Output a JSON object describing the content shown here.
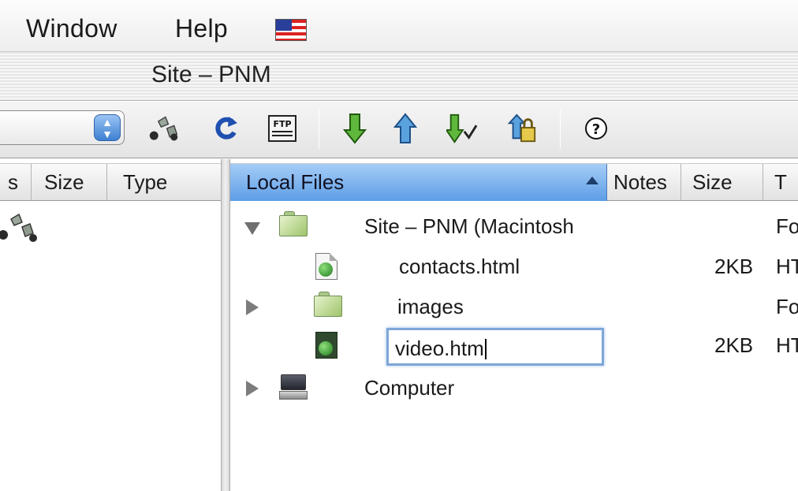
{
  "menu": {
    "items": [
      "Window",
      "Help"
    ],
    "flag_icon": "us-flag-icon"
  },
  "window": {
    "title": "Site – PNM"
  },
  "toolbar": {
    "buttons": [
      "connect-icon",
      "refresh-icon",
      "ftp-icon",
      "get-icon",
      "put-icon",
      "synchronize-icon",
      "check-in-icon",
      "help-icon"
    ],
    "ftp_label": "FTP",
    "help_label": "?"
  },
  "remote": {
    "columns": [
      "s",
      "Size",
      "Type"
    ]
  },
  "local": {
    "columns": [
      "Local Files",
      "Notes",
      "Size",
      "T"
    ],
    "rows": [
      {
        "name": "Site – PNM (Macintosh",
        "size": "",
        "type": "Fo"
      },
      {
        "name": "contacts.html",
        "size": "2KB",
        "type": "HT"
      },
      {
        "name": "images",
        "size": "",
        "type": "Fo"
      },
      {
        "name": "video.htm",
        "size": "2KB",
        "type": "HT"
      },
      {
        "name": "Computer",
        "size": "",
        "type": ""
      }
    ]
  },
  "colors": {
    "selected_header": "#5d9de6",
    "folder": "#9fc46b",
    "rename_border": "#7fa7d8"
  }
}
